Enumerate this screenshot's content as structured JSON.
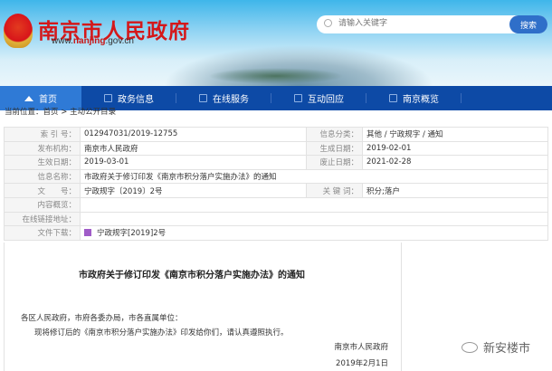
{
  "header": {
    "title": "南京市人民政府",
    "url_prefix": "www.",
    "url_bold": "nanjing",
    ".url_suffix": "",
    "url_rest": ".gov.cn",
    "search_placeholder": "请输入关键字",
    "search_button": "搜索"
  },
  "nav": [
    {
      "label": "首页"
    },
    {
      "label": "政务信息"
    },
    {
      "label": "在线服务"
    },
    {
      "label": "互动回应"
    },
    {
      "label": "南京概览"
    }
  ],
  "breadcrumb": {
    "label": "当前位置：",
    "home": "首页",
    "sep": ">",
    "current": "主动公开目录"
  },
  "meta": {
    "index_label": "索 引 号：",
    "index": "012947031/2019-12755",
    "category_label": "信息分类：",
    "category": "其他 / 宁政规字 / 通知",
    "publisher_label": "发布机构：",
    "publisher": "南京市人民政府",
    "created_label": "生成日期：",
    "created": "2019-02-01",
    "effective_label": "生效日期：",
    "effective": "2019-03-01",
    "expire_label": "废止日期：",
    "expire": "2021-02-28",
    "name_label": "信息名称：",
    "name": "市政府关于修订印发《南京市积分落户实施办法》的通知",
    "docno_label": "文　　号：",
    "docno": "宁政规字〔2019〕2号",
    "keywords_label": "关 键 词：",
    "keywords": "积分;落户",
    "summary_label": "内容概览：",
    "summary": "",
    "link_label": "在线链接地址：",
    "link": "",
    "download_label": "文件下载：",
    "download": "宁政规字[2019]2号"
  },
  "document": {
    "title": "市政府关于修订印发《南京市积分落户实施办法》的通知",
    "salutation": "各区人民政府，市府各委办局，市各直属单位：",
    "body": "现将修订后的《南京市积分落户实施办法》印发给你们，请认真遵照执行。",
    "signer": "南京市人民政府",
    "date": "2019年2月1日"
  },
  "watermark": "新安楼市"
}
